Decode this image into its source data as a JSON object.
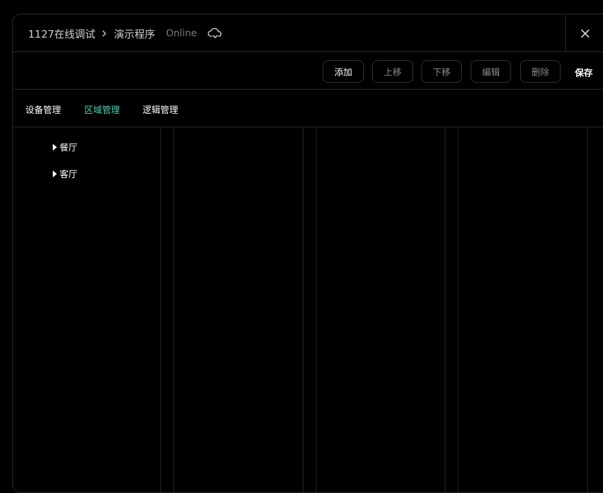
{
  "header": {
    "project_name": "1127在线调试",
    "program_name": "演示程序",
    "status": "Online",
    "icons": {
      "separator": "chevron-right-icon",
      "cloud": "cloud-sync-icon",
      "close": "close-icon"
    }
  },
  "toolbar": {
    "add_label": "添加",
    "move_up_label": "上移",
    "move_down_label": "下移",
    "edit_label": "编辑",
    "delete_label": "删除",
    "save_label": "保存"
  },
  "tabs": [
    {
      "label": "设备管理",
      "selected": false
    },
    {
      "label": "区域管理",
      "selected": true
    },
    {
      "label": "逻辑管理",
      "selected": false
    }
  ],
  "tree": {
    "items": [
      {
        "label": "餐厅",
        "icon": "caret-right-icon"
      },
      {
        "label": "客厅",
        "icon": "caret-right-icon"
      }
    ]
  },
  "colors": {
    "accent": "#4fd1b5",
    "background": "#000000",
    "border": "#2b2b2b"
  }
}
